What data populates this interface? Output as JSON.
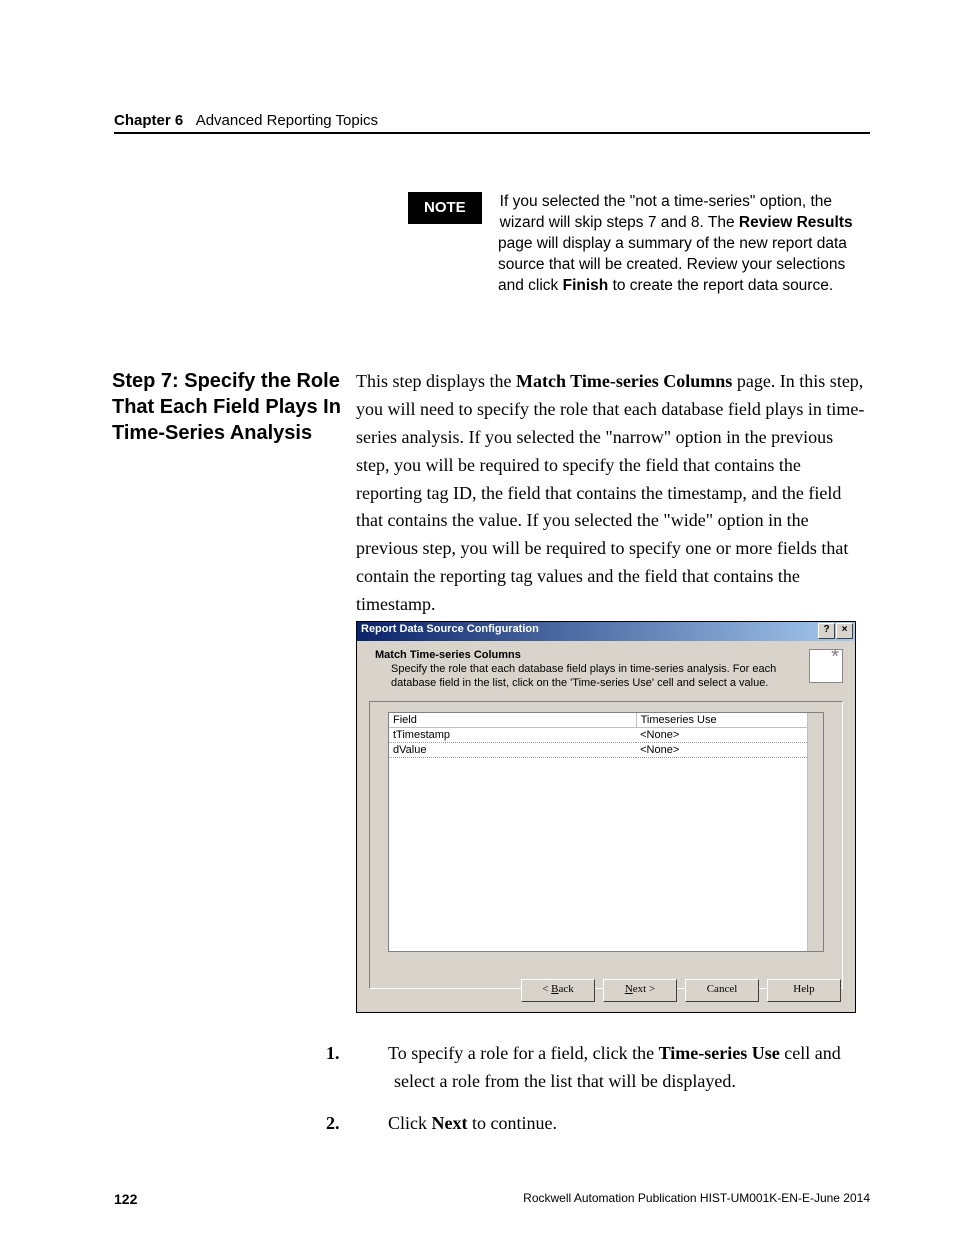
{
  "header": {
    "chapter": "Chapter 6",
    "title": "Advanced Reporting Topics"
  },
  "note": {
    "label": "NOTE",
    "text_pre": "If you selected the \"not a time-series\" option, the wizard will skip steps 7 and 8. The ",
    "bold1": "Review Results",
    "text_mid": " page will display a summary of the new report data source that will be created. Review your selections and click ",
    "bold2": "Finish",
    "text_end": " to create the report data source."
  },
  "step": {
    "heading": "Step 7: Specify the Role That Each Field Plays In Time-Series Analysis",
    "body_pre": "This step displays the ",
    "body_bold": "Match Time-series Columns",
    "body_post": " page. In this step, you will need to specify the role that each database field plays in time-series analysis. If you selected the \"narrow\" option in the previous step, you will be required to specify the field that contains the reporting tag ID, the field that contains the timestamp, and the field that contains the value. If you selected the \"wide\" option in the previous step, you will be required to specify one or more fields that contain the reporting tag values and the field that contains the timestamp."
  },
  "dialog": {
    "title": "Report Data Source Configuration",
    "subhead": "Match Time-series Columns",
    "desc": "Specify the role that each database field plays in time-series analysis.  For each database field in the list, click on the 'Time-series Use' cell and select a value.",
    "col1": "Field",
    "col2": "Timeseries Use",
    "rows": [
      {
        "f": "tTimestamp",
        "u": "<None>"
      },
      {
        "f": "dValue",
        "u": "<None>"
      }
    ],
    "btn_back_pre": "< ",
    "btn_back_u": "B",
    "btn_back_post": "ack",
    "btn_next_u": "N",
    "btn_next_post": "ext >",
    "btn_cancel": "Cancel",
    "btn_help": "Help",
    "help_btn": "?",
    "close_btn": "×"
  },
  "instructions": {
    "i1_num": "1.",
    "i1_pre": "To specify a role for a field, click the ",
    "i1_bold": "Time-series Use",
    "i1_post": " cell and select a role from the list that will be displayed.",
    "i2_num": "2.",
    "i2_pre": "Click ",
    "i2_bold": "Next",
    "i2_post": " to continue."
  },
  "footer": {
    "page": "122",
    "pub": "Rockwell Automation Publication HIST-UM001K-EN-E-June 2014"
  }
}
